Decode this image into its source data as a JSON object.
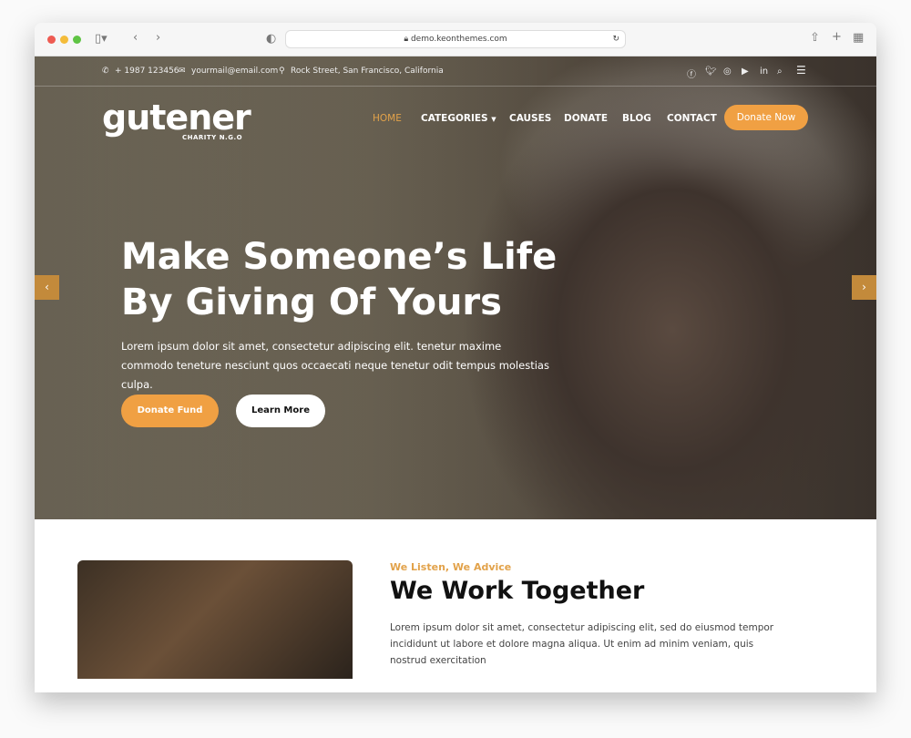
{
  "browser": {
    "url": "demo.keonthemes.com"
  },
  "topbar": {
    "phone": "+ 1987 123456",
    "email": "yourmail@email.com",
    "address": "Rock Street, San Francisco, California",
    "social": [
      "facebook-icon",
      "twitter-icon",
      "instagram-icon",
      "youtube-icon",
      "linkedin-icon"
    ]
  },
  "nav": {
    "logo": "gutener",
    "tagline": "CHARITY N.G.O",
    "items": [
      "HOME",
      "CATEGORIES",
      "CAUSES",
      "DONATE",
      "BLOG",
      "CONTACT"
    ],
    "cta": "Donate Now",
    "active_color": "#e2a24a"
  },
  "hero": {
    "title_line1": "Make Someone’s Life",
    "title_line2": "By Giving Of Yours",
    "text": "Lorem ipsum dolor sit amet, consectetur adipiscing elit. tenetur maxime commodo teneture nesciunt quos occaecati neque tenetur odit tempus molestias culpa.",
    "primary": "Donate Fund",
    "secondary": "Learn More"
  },
  "about": {
    "subtitle": "We Listen, We Advice",
    "title": "We Work Together",
    "text": "Lorem ipsum dolor sit amet, consectetur adipiscing elit, sed do eiusmod tempor incididunt ut labore et dolore magna aliqua. Ut enim ad minim veniam, quis nostrud exercitation"
  },
  "colors": {
    "accent": "#f0a043"
  }
}
